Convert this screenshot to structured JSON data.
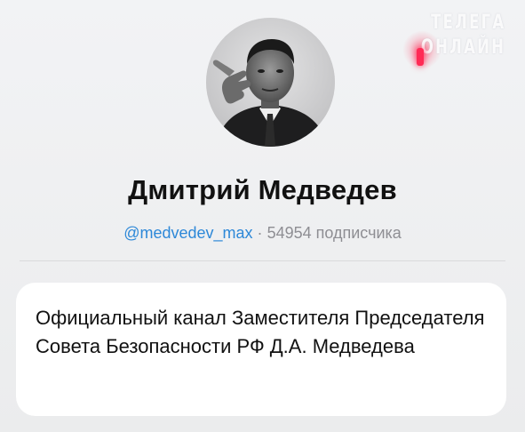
{
  "watermark": {
    "line1": "ТЕЛЕГА",
    "line2": "ОНЛАЙН"
  },
  "channel": {
    "name": "Дмитрий Медведев",
    "handle": "@medvedev_max",
    "separator": "·",
    "subscribers": "54954 подписчика",
    "description": "Официальный канал Заместителя Председателя Совета Безопасности РФ Д.А. Медведева"
  },
  "colors": {
    "handle": "#2d88d8",
    "watermark_accent": "#ff2a55"
  }
}
